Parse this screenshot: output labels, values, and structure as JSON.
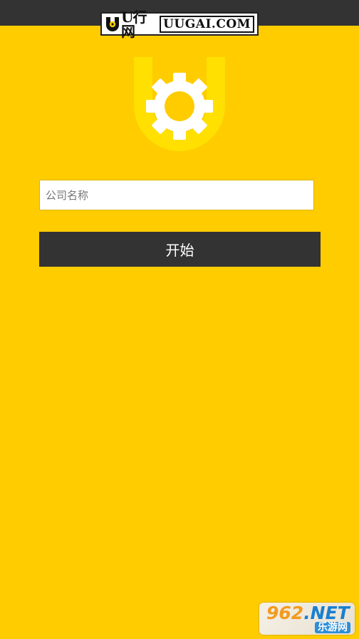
{
  "header": {
    "logo_cn": "U行网",
    "logo_en": "UUGAI.COM"
  },
  "form": {
    "company_placeholder": "公司名称",
    "company_value": "",
    "start_label": "开始"
  },
  "watermark": {
    "number": "962",
    "suffix": ".NET",
    "sub": "乐游网"
  },
  "colors": {
    "background": "#FFCC00",
    "status_bar": "#333333",
    "button": "#333333",
    "logo_u": "#FFE000",
    "gear": "#FFFFFF"
  },
  "icons": {
    "app_logo": "gear-icon"
  }
}
